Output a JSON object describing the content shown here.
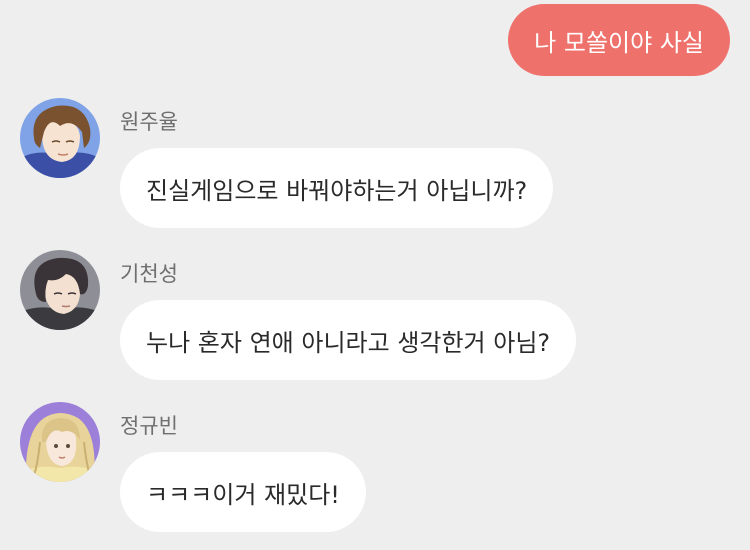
{
  "outgoing": {
    "text": "나 모쏠이야 사실"
  },
  "messages": [
    {
      "sender": "원주율",
      "avatar_icon": "boy-brown-hair-avatar-icon",
      "text": "진실게임으로 바꿔야하는거 아닙니까?"
    },
    {
      "sender": "기천성",
      "avatar_icon": "boy-black-hair-avatar-icon",
      "text": "누나 혼자 연애 아니라고 생각한거 아님?"
    },
    {
      "sender": "정규빈",
      "avatar_icon": "girl-blonde-hair-avatar-icon",
      "text": "ㅋㅋㅋ이거 재밌다!"
    }
  ],
  "colors": {
    "background": "#eeeeef",
    "outgoing_bubble": "#ef716c",
    "incoming_bubble": "#ffffff"
  }
}
